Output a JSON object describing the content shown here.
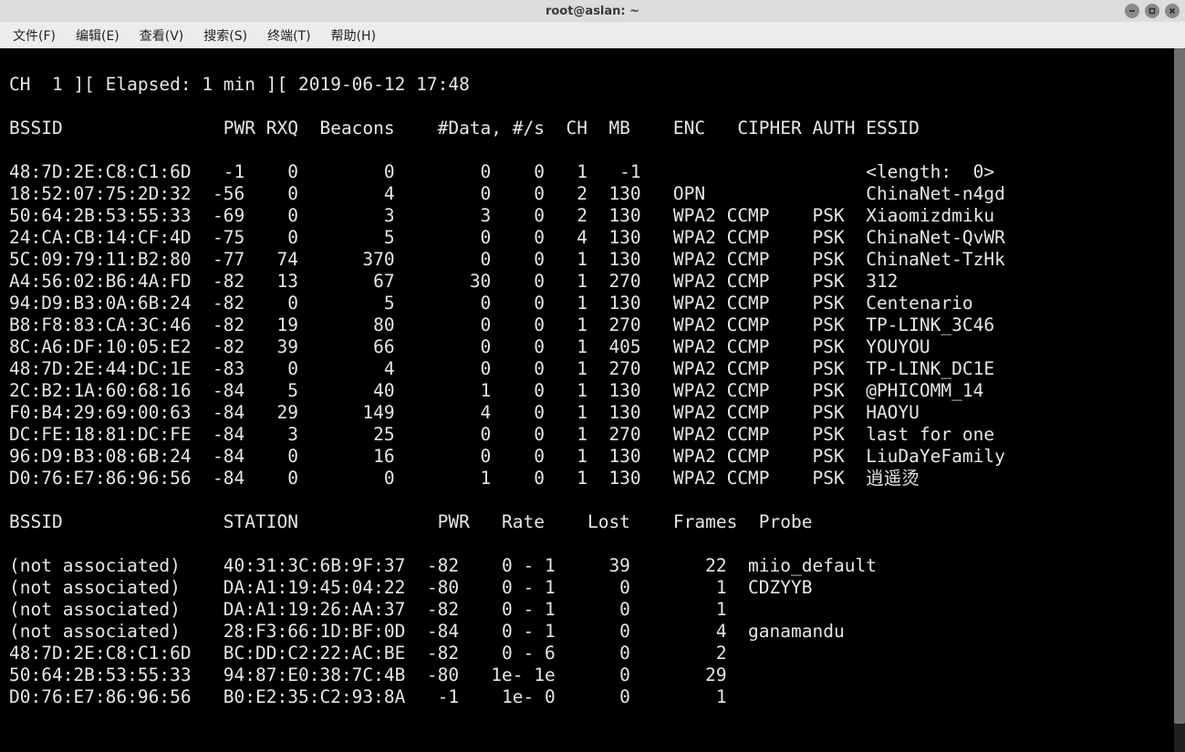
{
  "window": {
    "title": "root@aslan: ~"
  },
  "menu": {
    "file": "文件(F)",
    "edit": "编辑(E)",
    "view": "查看(V)",
    "search": "搜索(S)",
    "terminal": "终端(T)",
    "help": "帮助(H)"
  },
  "status_line": "CH  1 ][ Elapsed: 1 min ][ 2019-06-12 17:48",
  "ap_header": {
    "bssid": "BSSID",
    "pwr": "PWR",
    "rxq": "RXQ",
    "beacons": "Beacons",
    "data": "#Data,",
    "ps": "#/s",
    "ch": "CH",
    "mb": "MB",
    "enc": "ENC",
    "cipher": "CIPHER",
    "auth": "AUTH",
    "essid": "ESSID"
  },
  "aps": [
    {
      "bssid": "48:7D:2E:C8:C1:6D",
      "pwr": "-1",
      "rxq": "0",
      "beacons": "0",
      "data": "0",
      "ps": "0",
      "ch": "1",
      "mb": "-1",
      "enc": "",
      "cipher": "",
      "auth": "",
      "essid": "<length:  0>"
    },
    {
      "bssid": "18:52:07:75:2D:32",
      "pwr": "-56",
      "rxq": "0",
      "beacons": "4",
      "data": "0",
      "ps": "0",
      "ch": "2",
      "mb": "130",
      "enc": "OPN",
      "cipher": "",
      "auth": "",
      "essid": "ChinaNet-n4gd"
    },
    {
      "bssid": "50:64:2B:53:55:33",
      "pwr": "-69",
      "rxq": "0",
      "beacons": "3",
      "data": "3",
      "ps": "0",
      "ch": "2",
      "mb": "130",
      "enc": "WPA2",
      "cipher": "CCMP",
      "auth": "PSK",
      "essid": "Xiaomizdmiku"
    },
    {
      "bssid": "24:CA:CB:14:CF:4D",
      "pwr": "-75",
      "rxq": "0",
      "beacons": "5",
      "data": "0",
      "ps": "0",
      "ch": "4",
      "mb": "130",
      "enc": "WPA2",
      "cipher": "CCMP",
      "auth": "PSK",
      "essid": "ChinaNet-QvWR"
    },
    {
      "bssid": "5C:09:79:11:B2:80",
      "pwr": "-77",
      "rxq": "74",
      "beacons": "370",
      "data": "0",
      "ps": "0",
      "ch": "1",
      "mb": "130",
      "enc": "WPA2",
      "cipher": "CCMP",
      "auth": "PSK",
      "essid": "ChinaNet-TzHk"
    },
    {
      "bssid": "A4:56:02:B6:4A:FD",
      "pwr": "-82",
      "rxq": "13",
      "beacons": "67",
      "data": "30",
      "ps": "0",
      "ch": "1",
      "mb": "270",
      "enc": "WPA2",
      "cipher": "CCMP",
      "auth": "PSK",
      "essid": "312"
    },
    {
      "bssid": "94:D9:B3:0A:6B:24",
      "pwr": "-82",
      "rxq": "0",
      "beacons": "5",
      "data": "0",
      "ps": "0",
      "ch": "1",
      "mb": "130",
      "enc": "WPA2",
      "cipher": "CCMP",
      "auth": "PSK",
      "essid": "Centenario"
    },
    {
      "bssid": "B8:F8:83:CA:3C:46",
      "pwr": "-82",
      "rxq": "19",
      "beacons": "80",
      "data": "0",
      "ps": "0",
      "ch": "1",
      "mb": "270",
      "enc": "WPA2",
      "cipher": "CCMP",
      "auth": "PSK",
      "essid": "TP-LINK_3C46"
    },
    {
      "bssid": "8C:A6:DF:10:05:E2",
      "pwr": "-82",
      "rxq": "39",
      "beacons": "66",
      "data": "0",
      "ps": "0",
      "ch": "1",
      "mb": "405",
      "enc": "WPA2",
      "cipher": "CCMP",
      "auth": "PSK",
      "essid": "YOUYOU"
    },
    {
      "bssid": "48:7D:2E:44:DC:1E",
      "pwr": "-83",
      "rxq": "0",
      "beacons": "4",
      "data": "0",
      "ps": "0",
      "ch": "1",
      "mb": "270",
      "enc": "WPA2",
      "cipher": "CCMP",
      "auth": "PSK",
      "essid": "TP-LINK_DC1E"
    },
    {
      "bssid": "2C:B2:1A:60:68:16",
      "pwr": "-84",
      "rxq": "5",
      "beacons": "40",
      "data": "1",
      "ps": "0",
      "ch": "1",
      "mb": "130",
      "enc": "WPA2",
      "cipher": "CCMP",
      "auth": "PSK",
      "essid": "@PHICOMM_14"
    },
    {
      "bssid": "F0:B4:29:69:00:63",
      "pwr": "-84",
      "rxq": "29",
      "beacons": "149",
      "data": "4",
      "ps": "0",
      "ch": "1",
      "mb": "130",
      "enc": "WPA2",
      "cipher": "CCMP",
      "auth": "PSK",
      "essid": "HAOYU"
    },
    {
      "bssid": "DC:FE:18:81:DC:FE",
      "pwr": "-84",
      "rxq": "3",
      "beacons": "25",
      "data": "0",
      "ps": "0",
      "ch": "1",
      "mb": "270",
      "enc": "WPA2",
      "cipher": "CCMP",
      "auth": "PSK",
      "essid": "last for one"
    },
    {
      "bssid": "96:D9:B3:08:6B:24",
      "pwr": "-84",
      "rxq": "0",
      "beacons": "16",
      "data": "0",
      "ps": "0",
      "ch": "1",
      "mb": "130",
      "enc": "WPA2",
      "cipher": "CCMP",
      "auth": "PSK",
      "essid": "LiuDaYeFamily"
    },
    {
      "bssid": "D0:76:E7:86:96:56",
      "pwr": "-84",
      "rxq": "0",
      "beacons": "0",
      "data": "1",
      "ps": "0",
      "ch": "1",
      "mb": "130",
      "enc": "WPA2",
      "cipher": "CCMP",
      "auth": "PSK",
      "essid": "逍遥烫"
    }
  ],
  "sta_header": {
    "bssid": "BSSID",
    "station": "STATION",
    "pwr": "PWR",
    "rate": "Rate",
    "lost": "Lost",
    "frames": "Frames",
    "probe": "Probe"
  },
  "stas": [
    {
      "bssid": "(not associated)",
      "station": "40:31:3C:6B:9F:37",
      "pwr": "-82",
      "rate": "0 - 1",
      "lost": "39",
      "frames": "22",
      "probe": "miio_default"
    },
    {
      "bssid": "(not associated)",
      "station": "DA:A1:19:45:04:22",
      "pwr": "-80",
      "rate": "0 - 1",
      "lost": "0",
      "frames": "1",
      "probe": "CDZYYB"
    },
    {
      "bssid": "(not associated)",
      "station": "DA:A1:19:26:AA:37",
      "pwr": "-82",
      "rate": "0 - 1",
      "lost": "0",
      "frames": "1",
      "probe": ""
    },
    {
      "bssid": "(not associated)",
      "station": "28:F3:66:1D:BF:0D",
      "pwr": "-84",
      "rate": "0 - 1",
      "lost": "0",
      "frames": "4",
      "probe": "ganamandu"
    },
    {
      "bssid": "48:7D:2E:C8:C1:6D",
      "station": "BC:DD:C2:22:AC:BE",
      "pwr": "-82",
      "rate": "0 - 6",
      "lost": "0",
      "frames": "2",
      "probe": ""
    },
    {
      "bssid": "50:64:2B:53:55:33",
      "station": "94:87:E0:38:7C:4B",
      "pwr": "-80",
      "rate": "1e- 1e",
      "lost": "0",
      "frames": "29",
      "probe": ""
    },
    {
      "bssid": "D0:76:E7:86:96:56",
      "station": "B0:E2:35:C2:93:8A",
      "pwr": "-1",
      "rate": "1e- 0",
      "lost": "0",
      "frames": "1",
      "probe": ""
    }
  ]
}
